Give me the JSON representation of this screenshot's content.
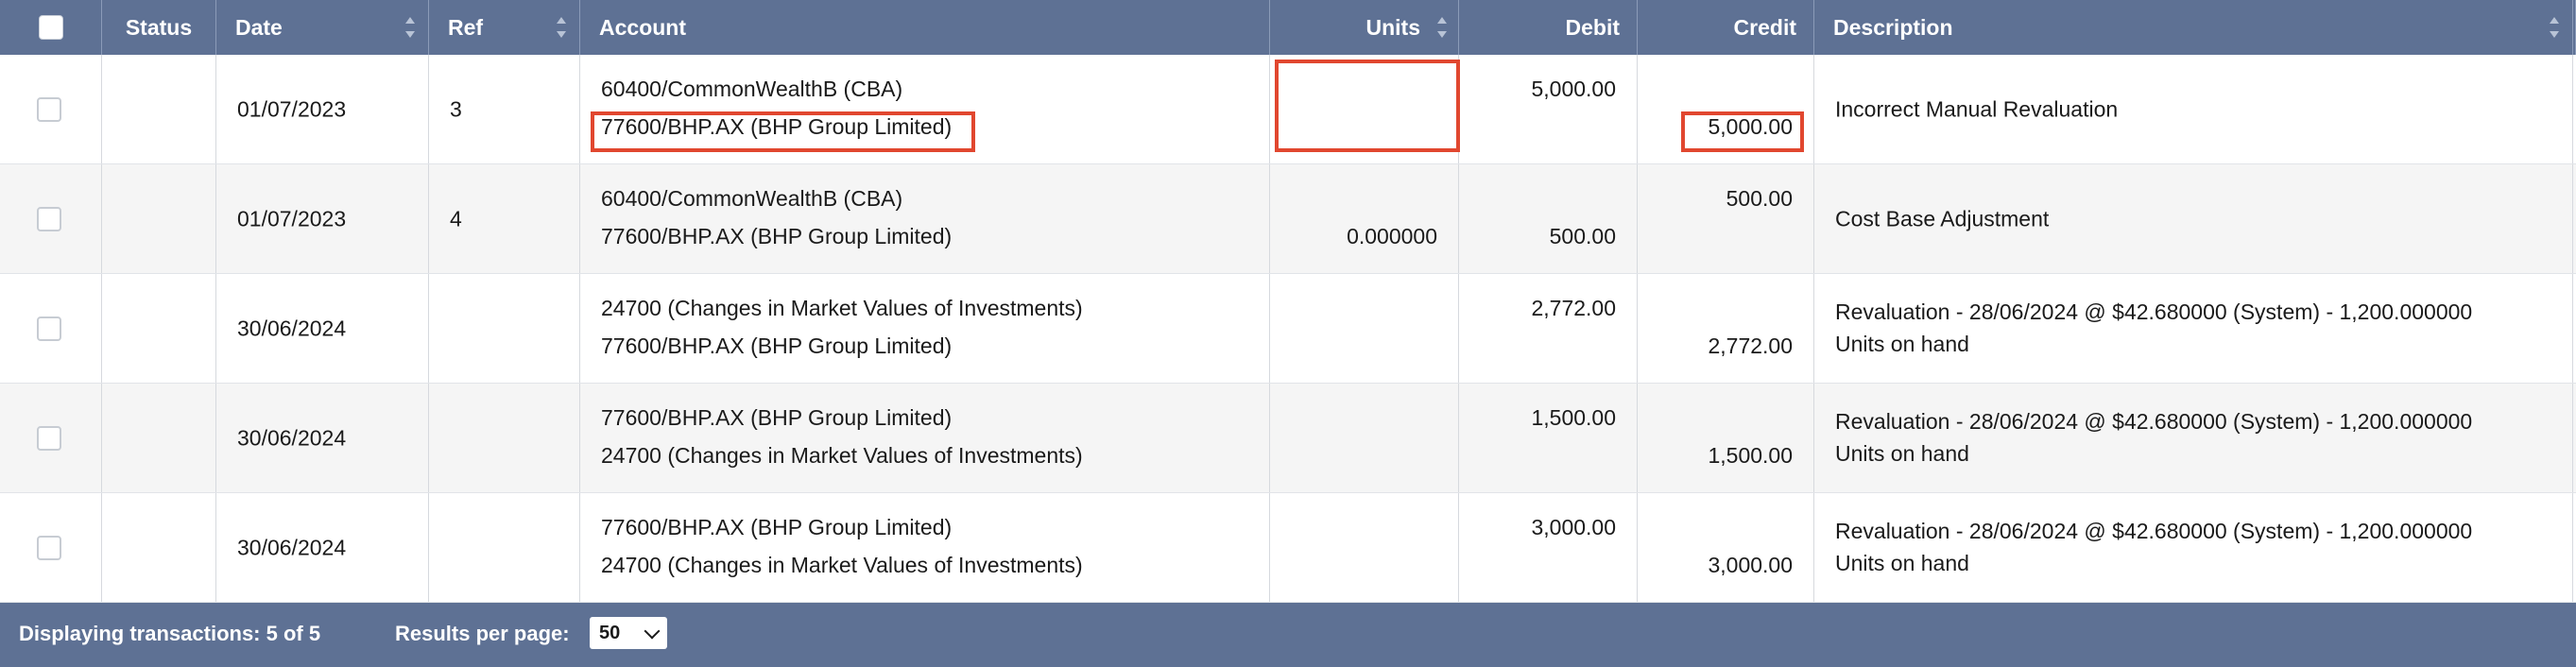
{
  "header": {
    "columns": {
      "status": "Status",
      "date": "Date",
      "ref": "Ref",
      "account": "Account",
      "units": "Units",
      "debit": "Debit",
      "credit": "Credit",
      "description": "Description"
    }
  },
  "rows": [
    {
      "date": "01/07/2023",
      "ref": "3",
      "account_line1": "60400/CommonWealthB (CBA)",
      "account_line2": "77600/BHP.AX (BHP Group Limited)",
      "units": "",
      "debit": "5,000.00",
      "credit": "5,000.00",
      "description_line1": "Incorrect Manual Revaluation",
      "description_line2": ""
    },
    {
      "date": "01/07/2023",
      "ref": "4",
      "account_line1": "60400/CommonWealthB (CBA)",
      "account_line2": "77600/BHP.AX (BHP Group Limited)",
      "units": "0.000000",
      "debit": "500.00",
      "credit": "500.00",
      "description_line1": "Cost Base Adjustment",
      "description_line2": ""
    },
    {
      "date": "30/06/2024",
      "ref": "",
      "account_line1": "24700 (Changes in Market Values of Investments)",
      "account_line2": "77600/BHP.AX (BHP Group Limited)",
      "units": "",
      "debit": "2,772.00",
      "credit": "2,772.00",
      "description_line1": "Revaluation - 28/06/2024 @ $42.680000 (System) - 1,200.000000",
      "description_line2": "Units on hand"
    },
    {
      "date": "30/06/2024",
      "ref": "",
      "account_line1": "77600/BHP.AX (BHP Group Limited)",
      "account_line2": "24700 (Changes in Market Values of Investments)",
      "units": "",
      "debit": "1,500.00",
      "credit": "1,500.00",
      "description_line1": "Revaluation - 28/06/2024 @ $42.680000 (System) - 1,200.000000",
      "description_line2": "Units on hand"
    },
    {
      "date": "30/06/2024",
      "ref": "",
      "account_line1": "77600/BHP.AX (BHP Group Limited)",
      "account_line2": "24700 (Changes in Market Values of Investments)",
      "units": "",
      "debit": "3,000.00",
      "credit": "3,000.00",
      "description_line1": "Revaluation - 28/06/2024 @ $42.680000 (System) - 1,200.000000",
      "description_line2": "Units on hand"
    }
  ],
  "footer": {
    "displaying": "Displaying transactions: 5 of 5",
    "results_per_page_label": "Results per page:",
    "results_per_page_value": "50"
  },
  "colors": {
    "header_bg": "#5e7194",
    "highlight": "#e1472f",
    "row_alt": "#f5f5f5"
  },
  "icons": [
    "select-all-checkbox",
    "sort-arrows-icon",
    "row-checkbox",
    "chevron-down-icon"
  ]
}
